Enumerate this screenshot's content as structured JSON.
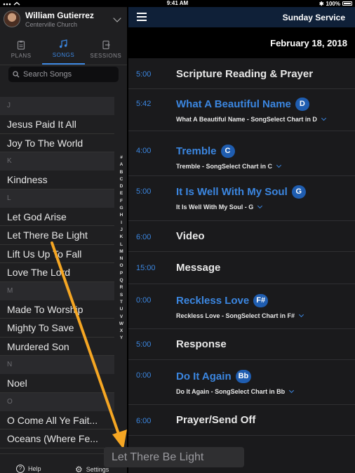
{
  "status": {
    "time": "9:41 AM",
    "battery": "100%"
  },
  "account": {
    "name": "William Gutierrez",
    "org": "Centerville Church"
  },
  "tabs": [
    {
      "label": "PLANS",
      "icon": "clipboard-icon"
    },
    {
      "label": "SONGS",
      "icon": "music-note-icon"
    },
    {
      "label": "SESSIONS",
      "icon": "sessions-icon"
    }
  ],
  "search": {
    "placeholder": "Search Songs"
  },
  "songs": {
    "J": [
      "Jesus Paid It All",
      "Joy To The World"
    ],
    "K": [
      "Kindness"
    ],
    "L": [
      "Let God Arise",
      "Let There Be Light",
      "Lift Us Up To Fall",
      "Love The Lord"
    ],
    "M": [
      "Made To Worship",
      "Mighty To Save",
      "Murdered Son"
    ],
    "N": [
      "Noel"
    ],
    "O": [
      "O Come All Ye Fait...",
      "Oceans (Where Fe..."
    ]
  },
  "section_labels": [
    "J",
    "K",
    "L",
    "M",
    "N",
    "O"
  ],
  "index_letters": [
    "#",
    "A",
    "B",
    "C",
    "D",
    "E",
    "F",
    "G",
    "H",
    "I",
    "J",
    "K",
    "L",
    "M",
    "N",
    "O",
    "P",
    "Q",
    "R",
    "S",
    "T",
    "U",
    "V",
    "W",
    "X",
    "Y"
  ],
  "footer": {
    "help": "Help",
    "settings": "Settings"
  },
  "plan": {
    "title": "Sunday Service",
    "date": "February 18, 2018",
    "items": [
      {
        "length": "5:00",
        "title": "Scripture Reading & Prayer",
        "type": "item"
      },
      {
        "length": "5:42",
        "title": "What A Beautiful Name",
        "key": "D",
        "type": "song",
        "arrangement": "What A Beautiful Name - SongSelect Chart in D"
      },
      {
        "length": "4:00",
        "title": "Tremble",
        "key": "C",
        "type": "song",
        "arrangement": "Tremble - SongSelect Chart in C"
      },
      {
        "length": "5:00",
        "title": "It Is Well With My Soul",
        "key": "G",
        "type": "song",
        "arrangement": "It Is Well With My Soul - G"
      },
      {
        "length": "6:00",
        "title": "Video",
        "type": "item"
      },
      {
        "length": "15:00",
        "title": "Message",
        "type": "item"
      },
      {
        "length": "0:00",
        "title": "Reckless Love",
        "key": "F#",
        "type": "song",
        "arrangement": "Reckless Love - SongSelect Chart in F#"
      },
      {
        "length": "5:00",
        "title": "Response",
        "type": "item"
      },
      {
        "length": "0:00",
        "title": "Do It Again",
        "key": "Bb",
        "type": "song",
        "arrangement": "Do It Again - SongSelect Chart in Bb"
      },
      {
        "length": "6:00",
        "title": "Prayer/Send Off",
        "type": "item"
      }
    ]
  },
  "drag": {
    "label": "Let There Be Light"
  },
  "colors": {
    "accent": "#3b86e0",
    "header": "#0f2038",
    "arrow": "#f5a623"
  }
}
